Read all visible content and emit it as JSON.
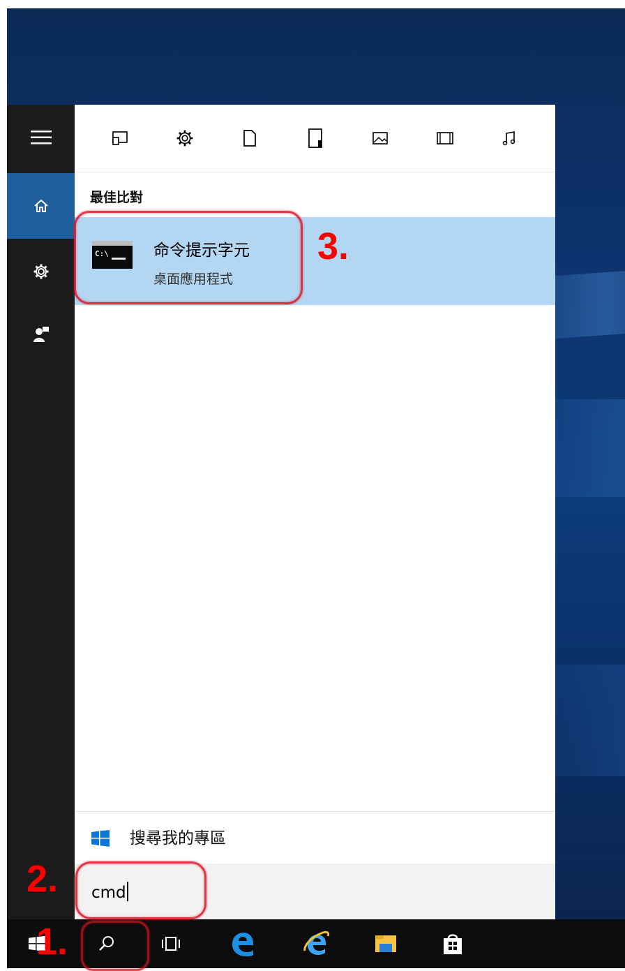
{
  "search_panel": {
    "section_label": "最佳比對",
    "best_match": {
      "title": "命令提示字元",
      "subtitle": "桌面應用程式",
      "icon": "command-prompt-icon",
      "icon_text": "C:\\"
    },
    "my_stuff_label": "搜尋我的專區",
    "search_value": "cmd",
    "filters": [
      "apps-icon",
      "settings-icon",
      "documents-icon",
      "folders-icon",
      "photos-icon",
      "videos-icon",
      "music-icon"
    ]
  },
  "rail": {
    "items": [
      "hamburger-menu-icon",
      "home-icon",
      "settings-icon",
      "feedback-icon"
    ]
  },
  "taskbar": {
    "items": [
      "windows-start-icon",
      "search-icon",
      "task-view-icon",
      "edge-icon",
      "internet-explorer-icon",
      "file-explorer-icon",
      "store-icon"
    ]
  },
  "annotations": {
    "step1": "1.",
    "step2": "2.",
    "step3": "3."
  },
  "colors": {
    "accent": "#1f5f9e",
    "selected_result": "#b3d7f3",
    "annotation": "#ff0000"
  }
}
